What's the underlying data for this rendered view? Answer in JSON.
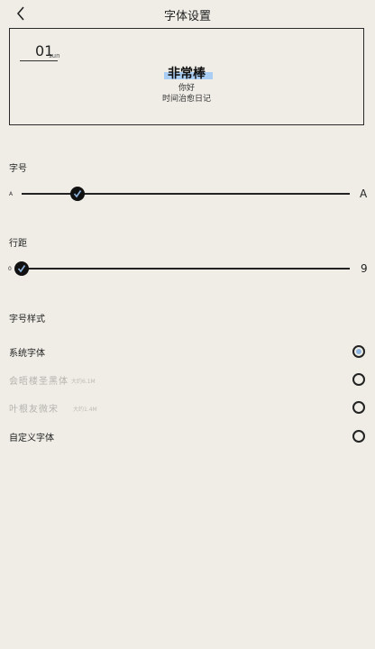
{
  "header": {
    "title": "字体设置"
  },
  "preview": {
    "day": "01",
    "weekday": "sun",
    "heading": "非常棒",
    "line1": "你好",
    "line2": "时间治愈日记"
  },
  "font_size": {
    "label": "字号",
    "min_label": "A",
    "max_label": "A",
    "value_fraction": 0.17
  },
  "line_spacing": {
    "label": "行距",
    "min_label": "0",
    "max_label": "9",
    "value": 0
  },
  "font_style": {
    "label": "字号样式",
    "options": [
      {
        "name": "系统字体",
        "size": "",
        "selected": true
      },
      {
        "name": "会晤楼圣黑体",
        "size": "大约6.1M",
        "selected": false
      },
      {
        "name": "叶根友微宋",
        "size": "大约1.4M",
        "selected": false
      },
      {
        "name": "自定义字体",
        "size": "",
        "selected": false
      }
    ]
  },
  "colors": {
    "background": "#efede6",
    "highlight": "#a9cdf3",
    "selected_radio": "#8fb4e0"
  }
}
